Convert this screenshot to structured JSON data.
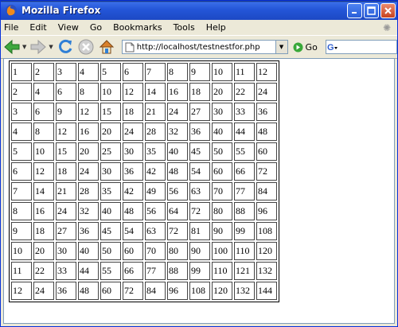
{
  "window": {
    "title": "Mozilla Firefox"
  },
  "menu": [
    "File",
    "Edit",
    "View",
    "Go",
    "Bookmarks",
    "Tools",
    "Help"
  ],
  "nav": {
    "url": "http://localhost/testnestfor.php",
    "go_label": "Go"
  },
  "table": {
    "rows": [
      [
        "1",
        "2",
        "3",
        "4",
        "5",
        "6",
        "7",
        "8",
        "9",
        "10",
        "11",
        "12"
      ],
      [
        "2",
        "4",
        "6",
        "8",
        "10",
        "12",
        "14",
        "16",
        "18",
        "20",
        "22",
        "24"
      ],
      [
        "3",
        "6",
        "9",
        "12",
        "15",
        "18",
        "21",
        "24",
        "27",
        "30",
        "33",
        "36"
      ],
      [
        "4",
        "8",
        "12",
        "16",
        "20",
        "24",
        "28",
        "32",
        "36",
        "40",
        "44",
        "48"
      ],
      [
        "5",
        "10",
        "15",
        "20",
        "25",
        "30",
        "35",
        "40",
        "45",
        "50",
        "55",
        "60"
      ],
      [
        "6",
        "12",
        "18",
        "24",
        "30",
        "36",
        "42",
        "48",
        "54",
        "60",
        "66",
        "72"
      ],
      [
        "7",
        "14",
        "21",
        "28",
        "35",
        "42",
        "49",
        "56",
        "63",
        "70",
        "77",
        "84"
      ],
      [
        "8",
        "16",
        "24",
        "32",
        "40",
        "48",
        "56",
        "64",
        "72",
        "80",
        "88",
        "96"
      ],
      [
        "9",
        "18",
        "27",
        "36",
        "45",
        "54",
        "63",
        "72",
        "81",
        "90",
        "99",
        "108"
      ],
      [
        "10",
        "20",
        "30",
        "40",
        "50",
        "60",
        "70",
        "80",
        "90",
        "100",
        "110",
        "120"
      ],
      [
        "11",
        "22",
        "33",
        "44",
        "55",
        "66",
        "77",
        "88",
        "99",
        "110",
        "121",
        "132"
      ],
      [
        "12",
        "24",
        "36",
        "48",
        "60",
        "72",
        "84",
        "96",
        "108",
        "120",
        "132",
        "144"
      ]
    ]
  }
}
